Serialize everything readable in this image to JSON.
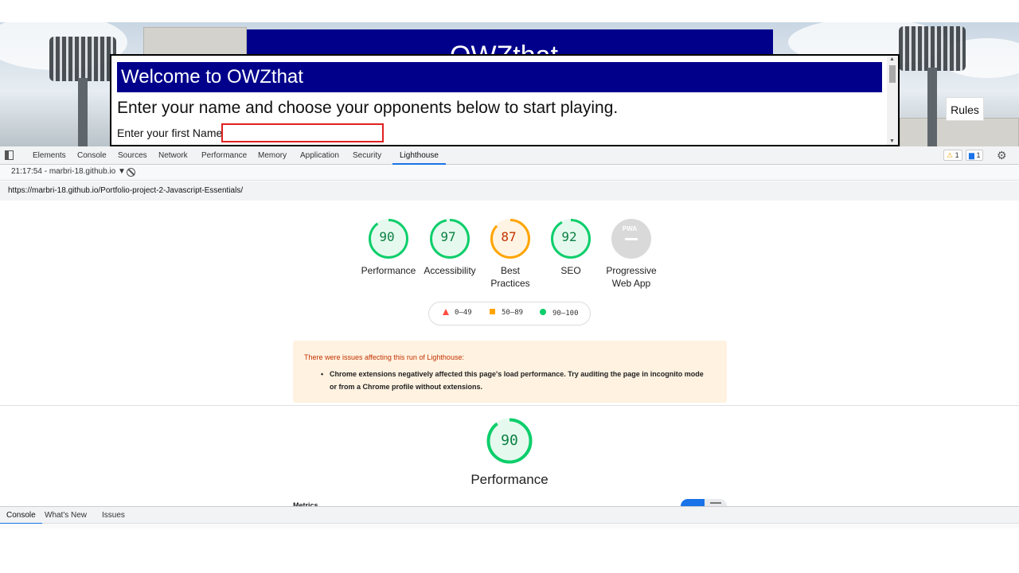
{
  "site": {
    "header_text": "OWZthat",
    "modal_title": "Welcome to OWZthat",
    "modal_subtitle": "Enter your name and choose your opponents below to start playing.",
    "name_label": "Enter your first Name*:",
    "name_value": "",
    "rules_button": "Rules"
  },
  "devtools": {
    "tabs": [
      "Elements",
      "Console",
      "Sources",
      "Network",
      "Performance",
      "Memory",
      "Application",
      "Security",
      "Lighthouse"
    ],
    "active_tab": "Lighthouse",
    "warnings_count": "1",
    "messages_count": "1",
    "report_select": "21:17:54 - marbri-18.github.io ▼",
    "url": "https://marbri-18.github.io/Portfolio-project-2-Javascript-Essentials/"
  },
  "lighthouse": {
    "gauges": [
      {
        "label": "Performance",
        "score": 90,
        "color": "#0cce6b",
        "text_color": "#0b8043",
        "fill": "#e6f9ee"
      },
      {
        "label": "Accessibility",
        "score": 97,
        "color": "#0cce6b",
        "text_color": "#0b8043",
        "fill": "#e6f9ee"
      },
      {
        "label": "Best Practices",
        "score": 87,
        "color": "#ffa400",
        "text_color": "#c33300",
        "fill": "#fff4e3"
      },
      {
        "label": "SEO",
        "score": 92,
        "color": "#0cce6b",
        "text_color": "#0b8043",
        "fill": "#e6f9ee"
      },
      {
        "label": "Progressive Web App",
        "score": null,
        "icon": "PWA",
        "color": "#d9d9d9",
        "text_color": "#ffffff",
        "fill": "#d9d9d9"
      }
    ],
    "legend": {
      "fail": "0–49",
      "average": "50–89",
      "pass": "90–100"
    },
    "issues_title": "There were issues affecting this run of Lighthouse:",
    "issues": [
      "Chrome extensions negatively affected this page's load performance. Try auditing the page in incognito mode or from a Chrome profile without extensions."
    ],
    "performance_score": 90,
    "performance_title": "Performance",
    "metrics_label": "Metrics"
  },
  "drawer": {
    "tabs": [
      "Console",
      "What's New",
      "Issues"
    ],
    "active_tab": "Console"
  }
}
